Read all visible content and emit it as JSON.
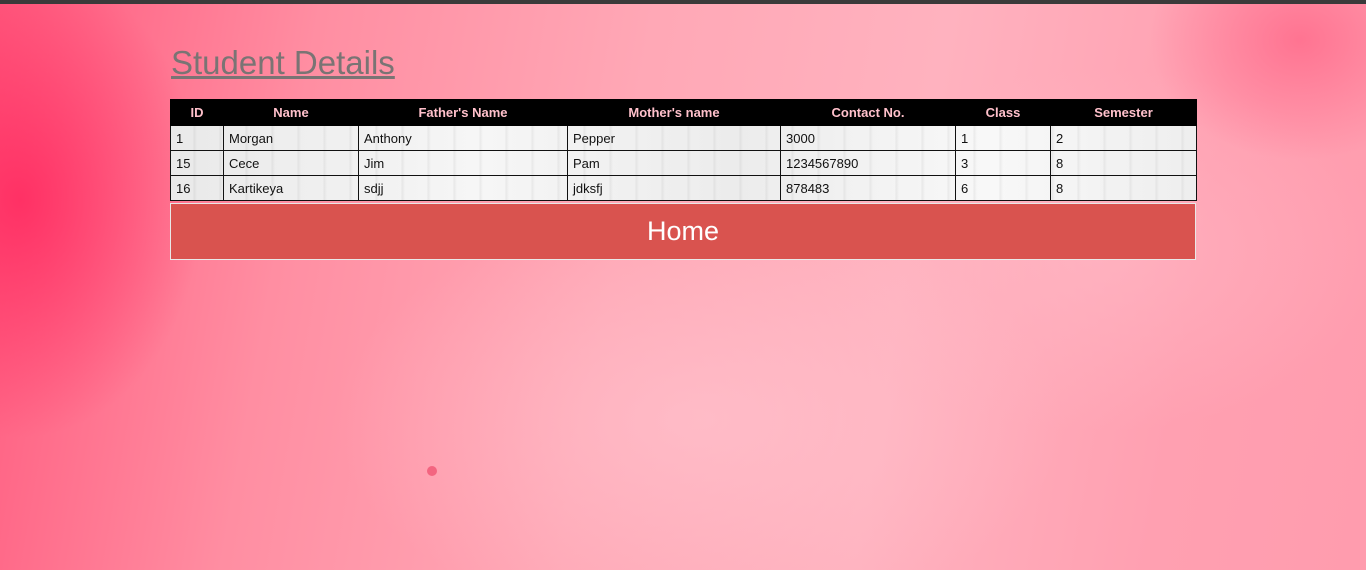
{
  "page": {
    "title": "Student Details"
  },
  "table": {
    "headers": [
      "ID",
      "Name",
      "Father's Name",
      "Mother's name",
      "Contact No.",
      "Class",
      "Semester"
    ],
    "rows": [
      [
        "1",
        "Morgan",
        "Anthony",
        "Pepper",
        "3000",
        "1",
        "2"
      ],
      [
        "15",
        "Cece",
        "Jim",
        "Pam",
        "1234567890",
        "3",
        "8"
      ],
      [
        "16",
        "Kartikeya",
        "sdjj",
        "jdksfj",
        "878483",
        "6",
        "8"
      ]
    ]
  },
  "home_button": {
    "label": "Home"
  },
  "colors": {
    "header_bg": "#000000",
    "header_text": "#ffc0cb",
    "button_bg": "#d9534f",
    "title_text": "#7a7474"
  }
}
